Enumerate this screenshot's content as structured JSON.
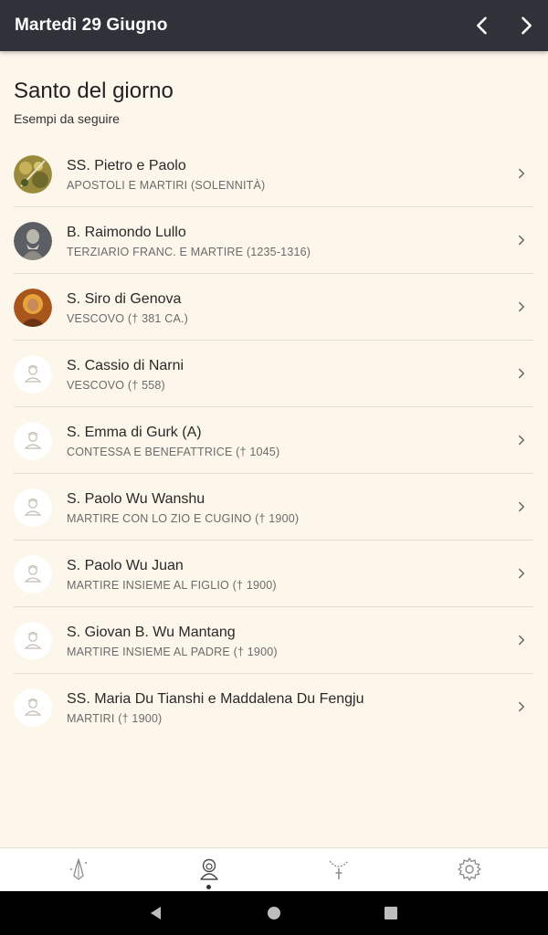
{
  "topbar": {
    "title": "Martedì 29 Giugno"
  },
  "header": {
    "title": "Santo del giorno",
    "subtitle": "Esempi da seguire"
  },
  "saints": [
    {
      "name": "SS. Pietro e Paolo",
      "desc": "APOSTOLI E MARTIRI (SOLENNITÀ)"
    },
    {
      "name": "B. Raimondo Lullo",
      "desc": "TERZIARIO FRANC. E MARTIRE (1235-1316)"
    },
    {
      "name": "S. Siro di Genova",
      "desc": "VESCOVO († 381 CA.)"
    },
    {
      "name": "S. Cassio di Narni",
      "desc": "VESCOVO († 558)"
    },
    {
      "name": "S. Emma di Gurk (A)",
      "desc": "CONTESSA E BENEFATTRICE († 1045)"
    },
    {
      "name": "S. Paolo Wu Wanshu",
      "desc": "MARTIRE CON LO ZIO E CUGINO († 1900)"
    },
    {
      "name": "S. Paolo Wu Juan",
      "desc": "MARTIRE INSIEME AL FIGLIO († 1900)"
    },
    {
      "name": "S. Giovan B. Wu Mantang",
      "desc": "MARTIRE INSIEME AL PADRE († 1900)"
    },
    {
      "name": "SS. Maria Du Tianshi e Maddalena Du Fengju",
      "desc": "MARTIRI († 1900)"
    }
  ],
  "bottom_nav": {
    "tabs": [
      "prayer-hands-icon",
      "saint-icon",
      "rosary-icon",
      "settings-gear-icon"
    ],
    "active_index": 1
  },
  "colors": {
    "topbar": "#2f3238",
    "background": "#fdf6ea",
    "divider": "#e8dfd1"
  }
}
